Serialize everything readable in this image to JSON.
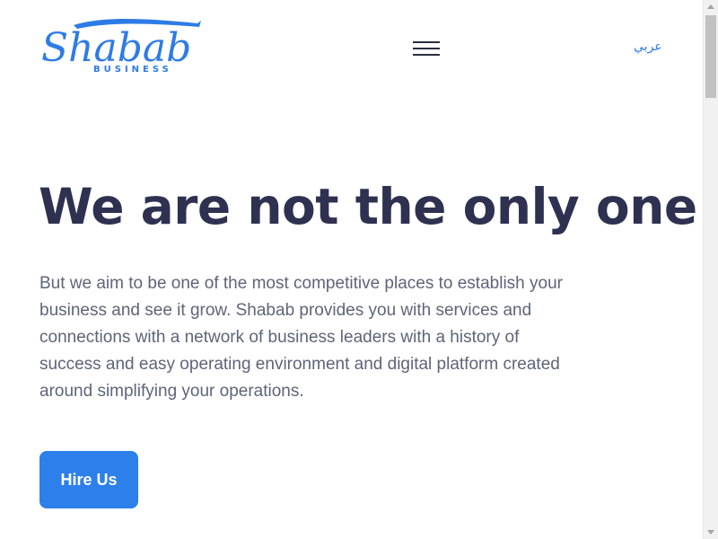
{
  "header": {
    "logo_text": "Shabab",
    "logo_subtext": "BUSINESS",
    "language_link": "عربي"
  },
  "hero": {
    "title": "We are not the only one",
    "description": "But we aim to be one of the most competitive places to establish your business and see it grow. Shabab provides you with services and connections with a network of business leaders with a history of success and easy operating environment and digital platform created around simplifying your operations.",
    "cta_label": "Hire Us"
  },
  "colors": {
    "brand_blue": "#2d7fe9",
    "heading": "#2e3150",
    "body_text": "#5f6478"
  },
  "icons": {
    "menu": "hamburger-icon"
  }
}
